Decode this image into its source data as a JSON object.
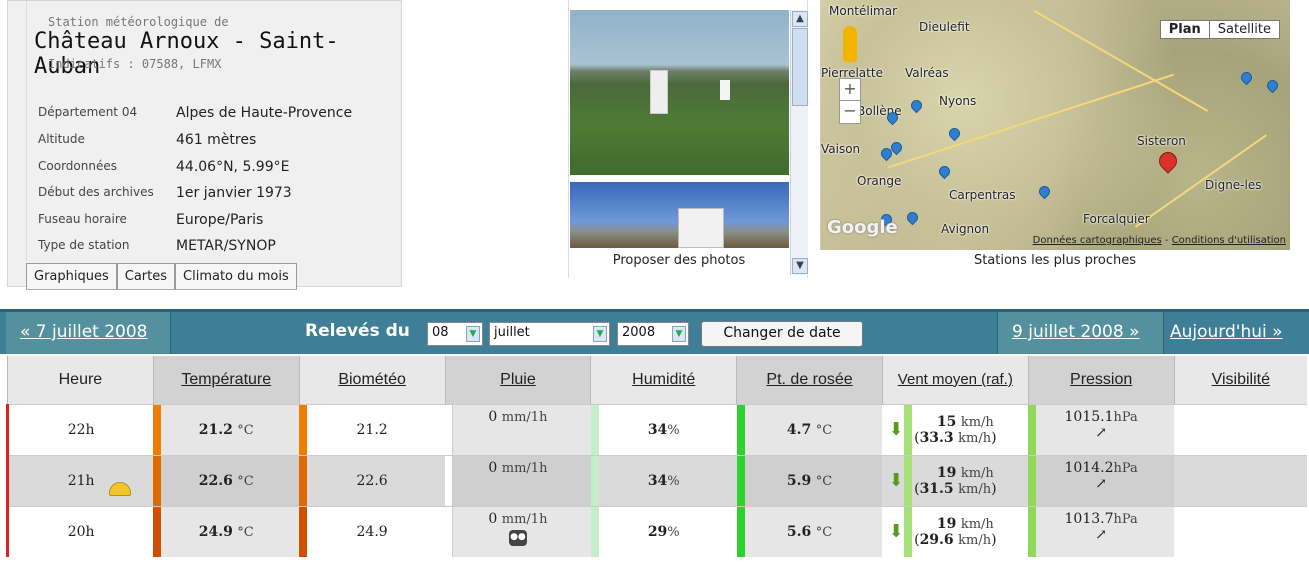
{
  "station": {
    "prefix": "Station météorologique de",
    "name": "Château Arnoux - Saint-Auban",
    "codes": "Indicatifs : 07588, LFMX",
    "fields": [
      {
        "key": "Département 04",
        "value": "Alpes de Haute-Provence"
      },
      {
        "key": "Altitude",
        "value": "461 mètres"
      },
      {
        "key": "Coordonnées",
        "value": "44.06°N, 5.99°E"
      },
      {
        "key": "Début des archives",
        "value": "1er janvier 1973"
      },
      {
        "key": "Fuseau horaire",
        "value": "Europe/Paris"
      },
      {
        "key": "Type de station",
        "value": "METAR/SYNOP"
      }
    ],
    "tabs": [
      "Graphiques",
      "Cartes",
      "Climato du mois"
    ]
  },
  "photos": {
    "label": "Proposer des photos"
  },
  "map": {
    "label": "Stations les plus proches",
    "map_type": [
      "Plan",
      "Satellite"
    ],
    "towns": [
      "Montélimar",
      "Dieulefit",
      "Pierrelatte",
      "Valréas",
      "Nyons",
      "Bollène",
      "Vaison",
      "Orange",
      "Carpentras",
      "Sisteron",
      "Digne-les",
      "Forcalquier",
      "Avignon"
    ],
    "logo": "Google",
    "attribution": [
      "Données cartographiques",
      "Conditions d'utilisation"
    ]
  },
  "nav": {
    "prev": "« 7 juillet 2008",
    "title": "Relevés du",
    "day": "08",
    "month": "juillet",
    "year": "2008",
    "button": "Changer de date",
    "next": "9 juillet 2008 »",
    "today": "Aujourd'hui »"
  },
  "table": {
    "headers": [
      "Heure",
      "Température",
      "Biométéo",
      "Pluie",
      "Humidité",
      "Pt. de rosée",
      "Vent moyen (raf.)",
      "Pression",
      "Visibilité"
    ],
    "rows": [
      {
        "hour": "22h",
        "temp": "21.2",
        "temp_unit": "°C",
        "bio": "21.2",
        "rain": "0",
        "rain_unit": "mm/1h",
        "hum": "34",
        "hum_unit": "%",
        "dew": "4.7",
        "dew_unit": "°C",
        "wind": "15",
        "wind_unit": "km/h",
        "gust": "33.3",
        "pres": "1015.1",
        "pres_unit": "hPa",
        "temp_color": "#f07c00",
        "dew_color": "#2fd12f"
      },
      {
        "hour": "21h",
        "temp": "22.6",
        "temp_unit": "°C",
        "bio": "22.6",
        "rain": "0",
        "rain_unit": "mm/1h",
        "hum": "34",
        "hum_unit": "%",
        "dew": "5.9",
        "dew_unit": "°C",
        "wind": "19",
        "wind_unit": "km/h",
        "gust": "31.5",
        "pres": "1014.2",
        "pres_unit": "hPa",
        "temp_color": "#e06a00",
        "dew_color": "#2fd12f"
      },
      {
        "hour": "20h",
        "temp": "24.9",
        "temp_unit": "°C",
        "bio": "24.9",
        "rain": "0",
        "rain_unit": "mm/1h",
        "hum": "29",
        "hum_unit": "%",
        "dew": "5.6",
        "dew_unit": "°C",
        "wind": "19",
        "wind_unit": "km/h",
        "gust": "29.6",
        "pres": "1013.7",
        "pres_unit": "hPa",
        "temp_color": "#d04f00",
        "dew_color": "#2fd12f"
      }
    ]
  }
}
